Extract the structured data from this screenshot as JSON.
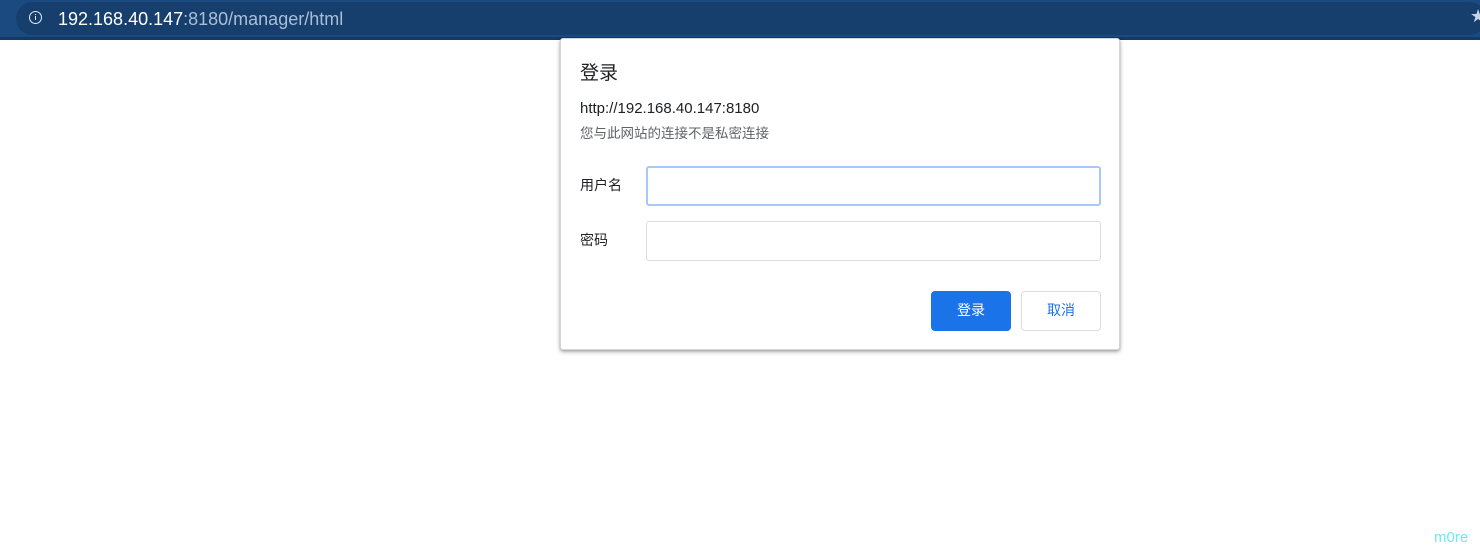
{
  "browser": {
    "url_host": "192.168.40.147",
    "url_rest": ":8180/manager/html",
    "info_icon": "info-circle-icon",
    "star_icon": "star-icon",
    "colors": {
      "toolbar": "#1a4a80",
      "url_host": "#ffffff",
      "url_rest": "#a9bfd8"
    }
  },
  "dialog": {
    "title": "登录",
    "origin": "http://192.168.40.147:8180",
    "warning": "您与此网站的连接不是私密连接",
    "username_label": "用户名",
    "username_value": "",
    "password_label": "密码",
    "password_value": "",
    "login_button": "登录",
    "cancel_button": "取消",
    "colors": {
      "primary": "#1a73e8",
      "focus_border": "#a8c7fa"
    }
  },
  "watermark": {
    "text": "m0re"
  }
}
